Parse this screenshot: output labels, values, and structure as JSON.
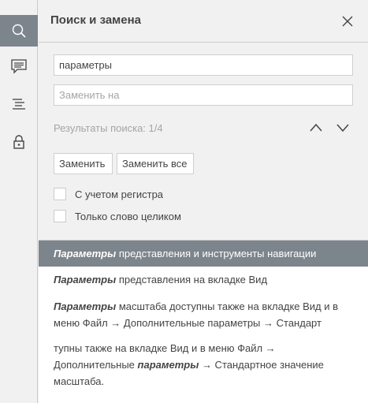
{
  "rail": {
    "items": [
      {
        "icon": "search-icon",
        "active": true
      },
      {
        "icon": "comments-icon",
        "active": false
      },
      {
        "icon": "navigation-icon",
        "active": false
      },
      {
        "icon": "lock-icon",
        "active": false
      }
    ]
  },
  "panel": {
    "title": "Поиск и замена",
    "find_value": "параметры",
    "replace_placeholder": "Заменить на",
    "results_label": "Результаты поиска: 1/4",
    "replace_button": "Заменить",
    "replace_all_button": "Заменить все",
    "case_label": "С учетом регистра",
    "whole_word_label": "Только слово целиком"
  },
  "results": [
    {
      "before": "",
      "match": "Параметры",
      "after": " представления и инструменты навигации",
      "selected": true
    },
    {
      "before": "",
      "match": "Параметры",
      "after": " представления на вкладке Вид",
      "selected": false
    },
    {
      "before": "",
      "match": "Параметры",
      "after": " масштаба доступны также на вкладке Вид и в меню Файл → Дополнительные параметры → Стандарт",
      "selected": false
    },
    {
      "before": "тупны также на вкладке Вид и в меню Файл → Дополнительные ",
      "match": "параметры",
      "after": " → Стандартное значение масштаба.",
      "selected": false
    }
  ],
  "colors": {
    "active_rail": "#7d858c",
    "selected_result": "#7d858c",
    "panel_bg": "#f1f1f1"
  }
}
